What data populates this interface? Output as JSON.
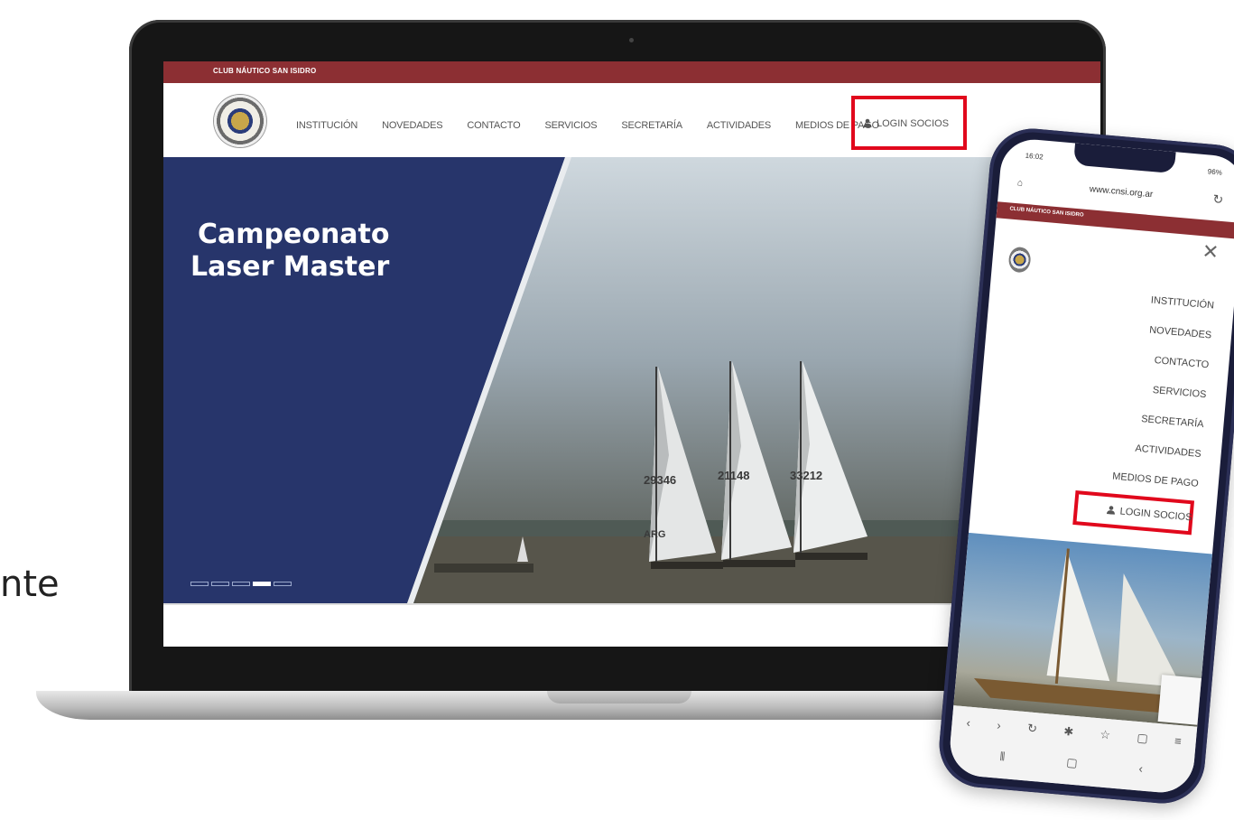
{
  "stray_text": "nte",
  "site": {
    "topbar_title": "CLUB NÁUTICO SAN ISIDRO",
    "nav": [
      "INSTITUCIÓN",
      "NOVEDADES",
      "CONTACTO",
      "SERVICIOS",
      "SECRETARÍA",
      "ACTIVIDADES",
      "MEDIOS DE PAGO"
    ],
    "login": "LOGIN SOCIOS",
    "hero_title_line1": "Campeonato",
    "hero_title_line2": "Laser Master",
    "sail_numbers": [
      "29346",
      "21148",
      "33212"
    ],
    "sail_country": "ARG"
  },
  "phone": {
    "time": "16:02",
    "battery": "96%",
    "url": "www.cnsi.org.ar",
    "topbar_title": "CLUB NÁUTICO SAN ISIDRO",
    "menu": [
      "INSTITUCIÓN",
      "NOVEDADES",
      "CONTACTO",
      "SERVICIOS",
      "SECRETARÍA",
      "ACTIVIDADES",
      "MEDIOS DE PAGO"
    ],
    "login": "LOGIN SOCIOS"
  },
  "colors": {
    "brand_red": "#8c2f33",
    "hero_navy": "#27356b",
    "highlight": "#e1081c"
  }
}
